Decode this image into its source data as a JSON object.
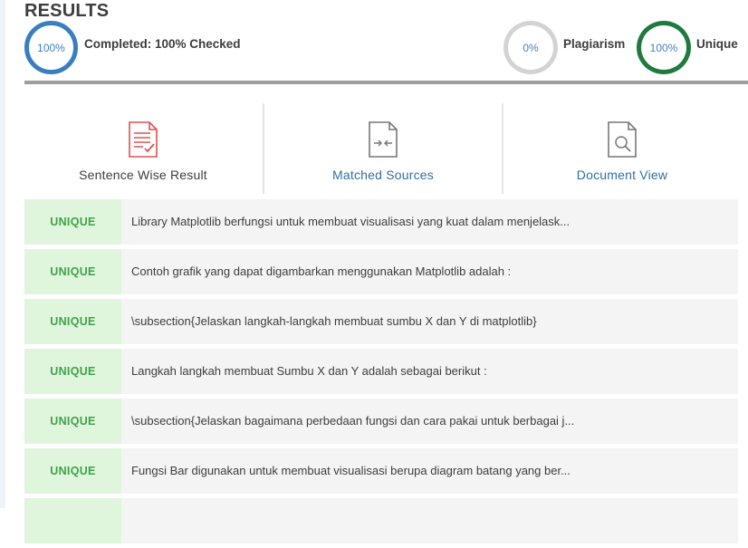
{
  "header": {
    "title": "RESULTS",
    "completed": {
      "percent_text": "100%",
      "label": "Completed: 100% Checked"
    },
    "plagiarism": {
      "percent_text": "0%",
      "label": "Plagiarism",
      "color": "#d3d3d3"
    },
    "unique": {
      "percent_text": "100%",
      "label": "Unique",
      "color": "#1e7a3e"
    },
    "accent": "#3b7ec0"
  },
  "tabs": [
    {
      "label": "Sentence Wise Result",
      "icon": "document-check-icon",
      "active": true
    },
    {
      "label": "Matched Sources",
      "icon": "document-compare-icon",
      "active": false
    },
    {
      "label": "Document View",
      "icon": "document-search-icon",
      "active": false
    }
  ],
  "results": [
    {
      "status": "UNIQUE",
      "text": "Library Matplotlib berfungsi untuk membuat visualisasi yang kuat dalam menjelask..."
    },
    {
      "status": "UNIQUE",
      "text": "Contoh grafik yang dapat digambarkan menggunakan Matplotlib adalah :"
    },
    {
      "status": "UNIQUE",
      "text": "\\subsection{Jelaskan langkah-langkah membuat sumbu X dan Y di matplotlib}"
    },
    {
      "status": "UNIQUE",
      "text": "Langkah langkah membuat Sumbu X dan Y adalah sebagai berikut :"
    },
    {
      "status": "UNIQUE",
      "text": "\\subsection{Jelaskan bagaimana perbedaan fungsi dan cara pakai untuk berbagai j..."
    },
    {
      "status": "UNIQUE",
      "text": "Fungsi Bar digunakan untuk membuat visualisasi berupa diagram batang yang ber..."
    },
    {
      "status": "",
      "text": ""
    }
  ]
}
